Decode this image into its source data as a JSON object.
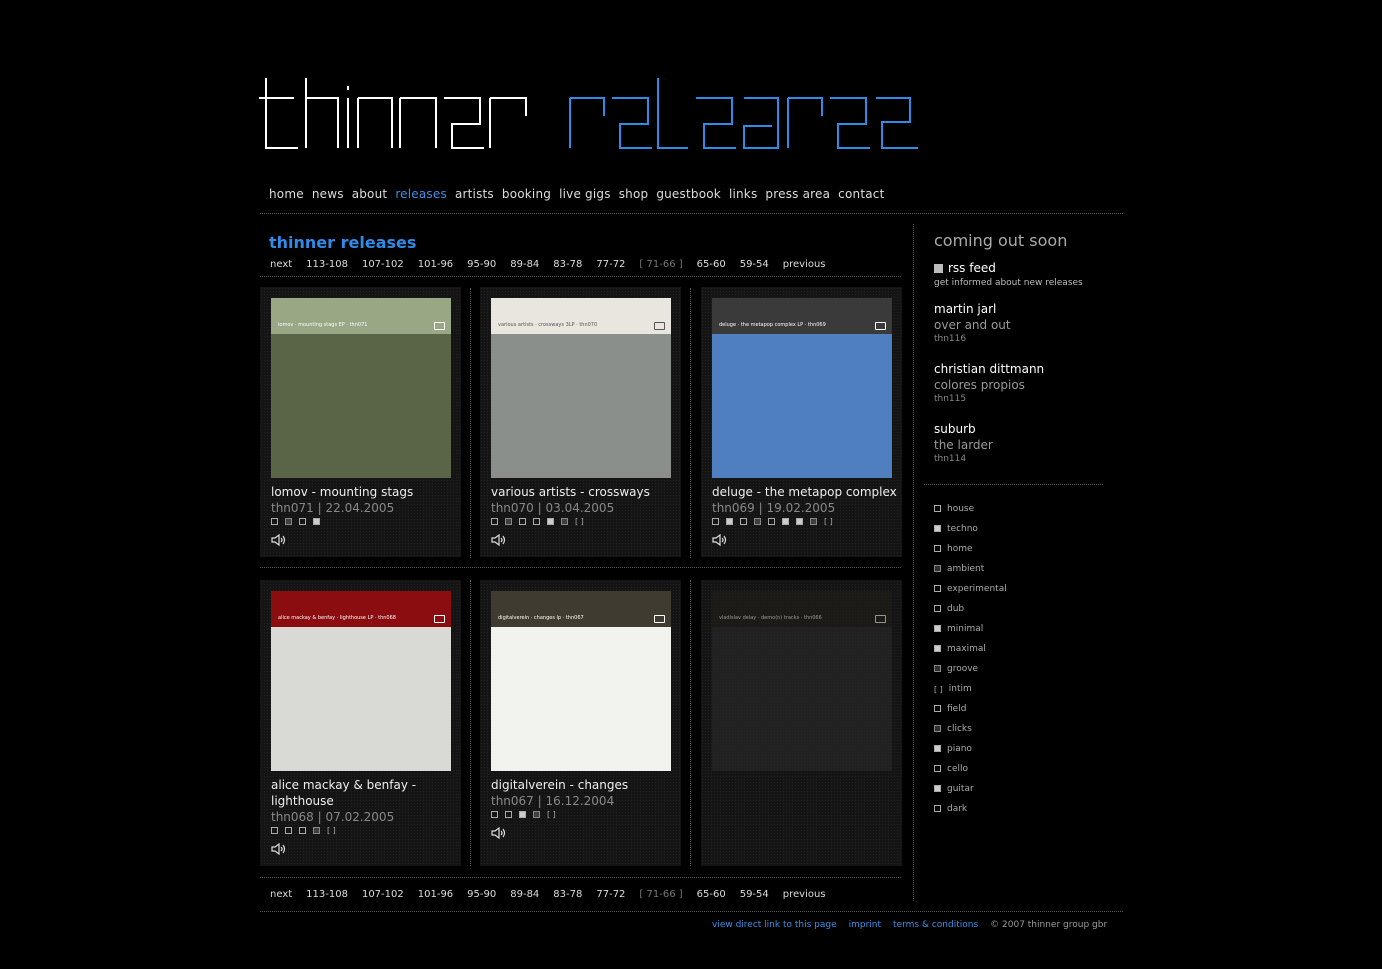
{
  "logo": {
    "part1": "thinner",
    "part2": "releases"
  },
  "nav": [
    "home",
    "news",
    "about",
    "releases",
    "artists",
    "booking",
    "live gigs",
    "shop",
    "guestbook",
    "links",
    "press area",
    "contact"
  ],
  "nav_active": "releases",
  "page_title": "thinner releases",
  "pager": {
    "items": [
      "next",
      "113-108",
      "107-102",
      "101-96",
      "95-90",
      "89-84",
      "83-78",
      "77-72",
      "[ 71-66 ]",
      "65-60",
      "59-54",
      "previous"
    ],
    "current": "[ 71-66 ]"
  },
  "releases": [
    {
      "title": "lomov - mounting stags",
      "meta": "thn071 | 22.04.2005",
      "cover_text": "lomov  ·  mounting stags EP  ·  thn071",
      "cover_band": "#9aa785",
      "cover_bg": "#5a6548",
      "tags": [
        "grid",
        "dots",
        "box",
        "minus"
      ]
    },
    {
      "title": "various artists - crossways",
      "meta": "thn070 | 03.04.2005",
      "cover_text": "various artists  ·  crossways 3LP  ·  thn070",
      "cover_band": "#e8e6df",
      "cover_bg": "#8b8f8c",
      "tags": [
        "grid",
        "dots",
        "x",
        "box",
        "minus",
        "check",
        "bracket"
      ]
    },
    {
      "title": "deluge - the metapop complex",
      "meta": "thn069 | 19.02.2005",
      "cover_text": "deluge  ·  the metapop complex LP  ·  thn069",
      "cover_band": "#3a3a3a",
      "cover_bg": "#4f7fbf",
      "tags": [
        "x",
        "bars",
        "grid",
        "dots",
        "x",
        "minus",
        "plus",
        "check",
        "bracket"
      ]
    },
    {
      "title": "alice mackay & benfay - lighthouse",
      "meta": "thn068 | 07.02.2005",
      "cover_text": "alice mackay & benfay  ·  lighthouse LP  ·  thn068",
      "cover_band": "#8b0d10",
      "cover_bg": "#d9d9d6",
      "tags": [
        "x",
        "grid",
        "box",
        "check",
        "bracket"
      ]
    },
    {
      "title": "digitalverein - changes",
      "meta": "thn067 | 16.12.2004",
      "cover_text": "digitalverein  ·  changes lp  ·  thn067",
      "cover_band": "#403b30",
      "cover_bg": "#f2f2ef",
      "tags": [
        "grid",
        "box",
        "minus",
        "check",
        "bracket"
      ]
    },
    {
      "title": "",
      "meta": "",
      "cover_text": "vladislav delay  ·  demo(n) tracks  ·  thn066",
      "cover_band": "#221f1a",
      "cover_bg": "#2c2c2c",
      "tags": []
    }
  ],
  "sidebar": {
    "title": "coming out soon",
    "rss_label": "rss feed",
    "rss_note": "get informed about new releases",
    "upcoming": [
      {
        "artist": "martin jarl",
        "title": "over and out",
        "cat": "thn116"
      },
      {
        "artist": "christian dittmann",
        "title": "colores propios",
        "cat": "thn115"
      },
      {
        "artist": "suburb",
        "title": "the larder",
        "cat": "thn114"
      }
    ],
    "genres": [
      "house",
      "techno",
      "home",
      "ambient",
      "experimental",
      "dub",
      "minimal",
      "maximal",
      "groove",
      "intim",
      "field",
      "clicks",
      "piano",
      "cello",
      "guitar",
      "dark"
    ]
  },
  "footer": {
    "link1": "view direct link to this page",
    "link2": "imprint",
    "link3": "terms & conditions",
    "copyright": "© 2007 thinner group gbr"
  },
  "colors": {
    "accent": "#2f8ae8",
    "background": "#000000",
    "text": "#ffffff"
  }
}
